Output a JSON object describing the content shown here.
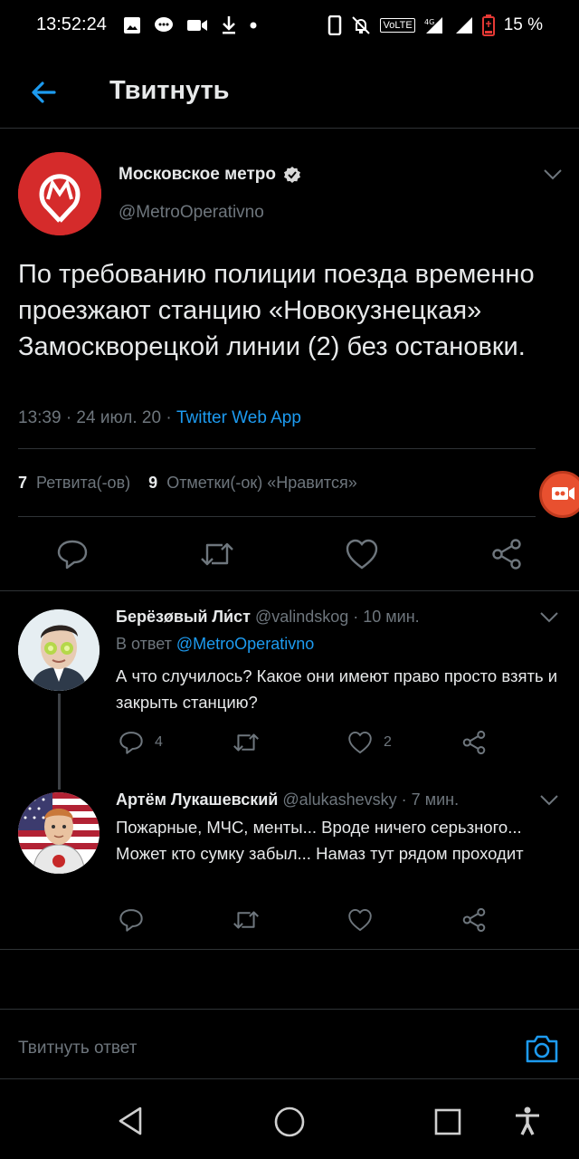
{
  "status_bar": {
    "time": "13:52:24",
    "network": "VoLTE",
    "network_gen": "4G",
    "battery": "15 %"
  },
  "header": {
    "title": "Твитнуть"
  },
  "tweet": {
    "author_name": "Московское метро",
    "author_handle": "@MetroOperativno",
    "text": "По требованию полиции поезда временно проезжают станцию «Новокузнецкая» Замоскворецкой линии (2) без остановки.",
    "time": "13:39 · 24 июл. 20 · ",
    "source": "Twitter Web App",
    "retweets_count": "7",
    "retweets_label": "Ретвита(-ов)",
    "likes_count": "9",
    "likes_label": "Отметки(-ок) «Нравится»"
  },
  "replies": [
    {
      "name": "Берёзøвый Ли́ст",
      "handle": "@valindskog · 10 мин.",
      "in_reply_prefix": "В ответ ",
      "in_reply_mention": "@MetroOperativno",
      "text": "А что случилось? Какое они имеют право просто взять и закрыть станцию?",
      "reply_count": "4",
      "retweet_count": "",
      "like_count": "2"
    },
    {
      "name": "Артём Лукашевский",
      "handle": "@alukashevsky · 7 мин.",
      "text": "Пожарные, МЧС, менты... Вроде ничего серьзного... Может кто сумку забыл... Намаз тут рядом проходит",
      "reply_count": "",
      "retweet_count": "",
      "like_count": ""
    }
  ],
  "reply_bar": {
    "placeholder": "Твитнуть ответ"
  },
  "colors": {
    "accent": "#1d9bf0",
    "metro_red": "#d52b2b",
    "muted": "#6e767d",
    "divider": "#2f3336"
  }
}
